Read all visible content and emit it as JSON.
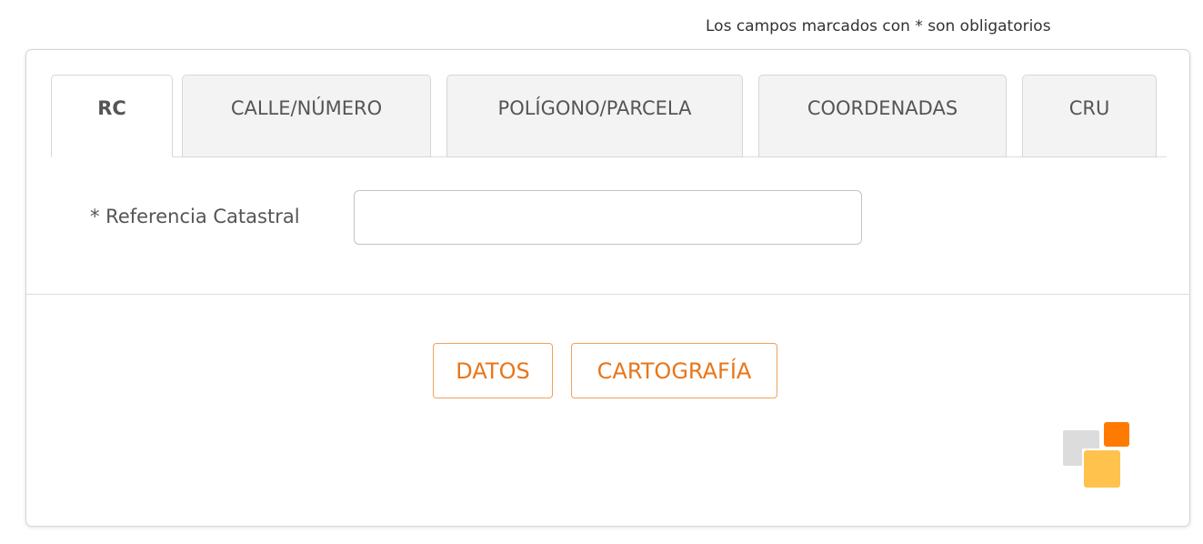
{
  "header": {
    "required_note": "Los campos marcados con * son obligatorios"
  },
  "tabs": [
    {
      "label": "RC",
      "active": true
    },
    {
      "label": "CALLE/NÚMERO",
      "active": false
    },
    {
      "label": "POLÍGONO/PARCELA",
      "active": false
    },
    {
      "label": "COORDENADAS",
      "active": false
    },
    {
      "label": "CRU",
      "active": false
    }
  ],
  "form": {
    "referencia": {
      "label": "* Referencia Catastral",
      "value": "",
      "placeholder": ""
    }
  },
  "actions": {
    "datos_label": "DATOS",
    "cartografia_label": "CARTOGRAFÍA"
  },
  "logo": {
    "icon": "catastro-logo-icon",
    "colors": {
      "gray": "#dcdcdc",
      "orange": "#ff7a00",
      "yellow": "#ffc34d"
    }
  },
  "theme": {
    "accent": "#e8761a",
    "accent_border": "#f0a15c"
  }
}
